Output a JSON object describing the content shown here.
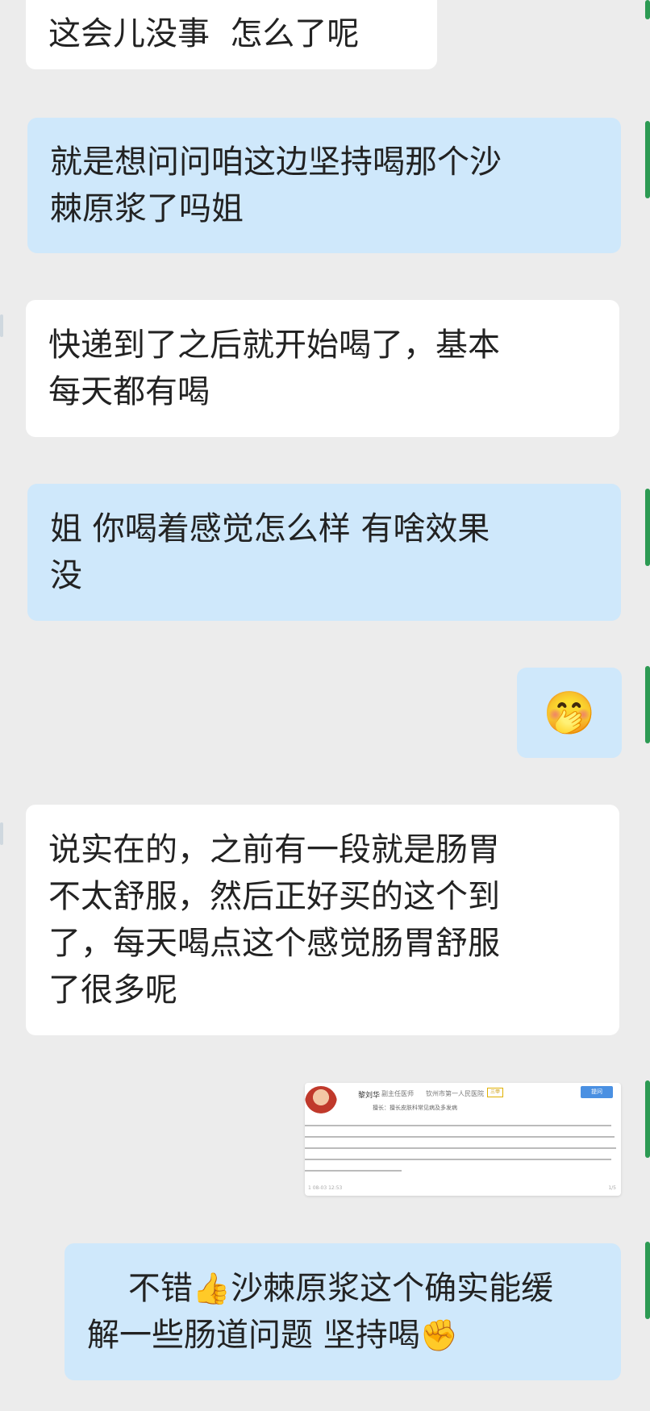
{
  "messages": [
    {
      "side": "in",
      "text": "这会儿没事  怎么了呢"
    },
    {
      "side": "out",
      "text": "就是想问问咱这边坚持喝那个沙\n棘原浆了吗姐"
    },
    {
      "side": "in",
      "text": "快递到了之后就开始喝了，基本\n每天都有喝"
    },
    {
      "side": "out",
      "text": "姐 你喝着感觉怎么样 有啥效果\n没"
    },
    {
      "side": "out",
      "emoji": "🤭"
    },
    {
      "side": "in",
      "text": "说实在的，之前有一段就是肠胃\n不太舒服，然后正好买的这个到\n了，每天喝点这个感觉肠胃舒服\n了很多呢"
    },
    {
      "side": "out",
      "text_parts": [
        "不错",
        "👍",
        "沙棘原浆这个确实能缓\n解一些肠道问题 坚持喝",
        "✊"
      ]
    }
  ],
  "card": {
    "name": "黎刘华",
    "title": "副主任医师",
    "hospital": "钦州市第一人民医院",
    "tag": "三甲",
    "ask_label": "提问",
    "specialty": "擅长：擅长皮肤科常见病及多发病",
    "time": "1 08-03 12:53",
    "page": "1/5"
  },
  "colors": {
    "incoming": "#ffffff",
    "outgoing": "#cfe8fb",
    "background": "#ececec",
    "edge_green": "#2c9a53"
  }
}
